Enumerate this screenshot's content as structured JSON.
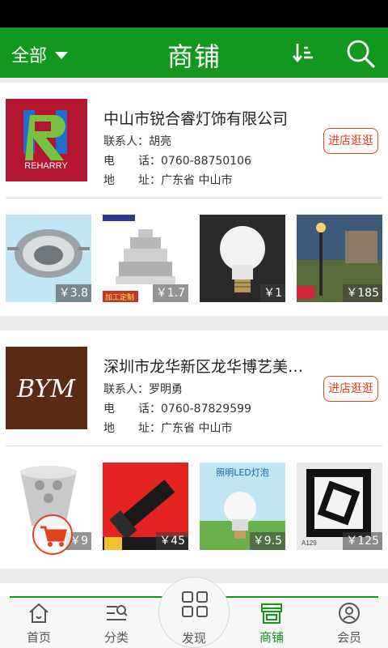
{
  "header": {
    "filter_label": "全部",
    "title": "商铺"
  },
  "shops": [
    {
      "name": "中山市锐合睿灯饰有限公司",
      "logo_text": "REHARRY",
      "contact_label": "联系人：",
      "contact": "胡亮",
      "phone_label_a": "电",
      "phone_label_b": "话：",
      "phone": "0760-88750106",
      "addr_label_a": "地",
      "addr_label_b": "址：",
      "address": "广东省 中山市",
      "visit_label": "进店逛逛",
      "products": [
        {
          "price": "￥3.8",
          "tag": ""
        },
        {
          "price": "￥1.7",
          "tag": "加工定制"
        },
        {
          "price": "￥1",
          "tag": ""
        },
        {
          "price": "￥185",
          "tag": ""
        }
      ]
    },
    {
      "name": "深圳市龙华新区龙华博艺美灯饰",
      "logo_text": "BYM",
      "contact_label": "联系人：",
      "contact": "罗明勇",
      "phone_label_a": "电",
      "phone_label_b": "话：",
      "phone": "0760-87829599",
      "addr_label_a": "地",
      "addr_label_b": "址：",
      "address": "广东省 中山市",
      "visit_label": "进店逛逛",
      "products": [
        {
          "price": "￥9",
          "tag": ""
        },
        {
          "price": "￥45",
          "tag": ""
        },
        {
          "price": "￥9.5",
          "tag": "照明LED灯泡"
        },
        {
          "price": "￥125",
          "tag": "A129"
        }
      ]
    }
  ],
  "tabbar": {
    "items": [
      {
        "label": "首页",
        "icon": "home-icon"
      },
      {
        "label": "分类",
        "icon": "category-icon"
      },
      {
        "label": "发现",
        "icon": "discover-icon"
      },
      {
        "label": "商铺",
        "icon": "shop-icon"
      },
      {
        "label": "会员",
        "icon": "member-icon"
      }
    ],
    "active": "商铺"
  },
  "colors": {
    "brand_green": "#13971c",
    "accent_red": "#e2411d"
  }
}
